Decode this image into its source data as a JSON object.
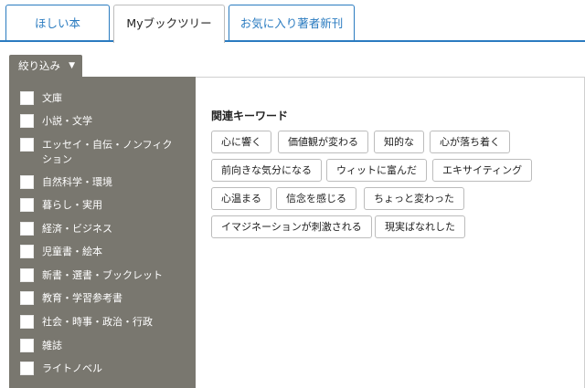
{
  "tabs": [
    {
      "label": "ほしい本"
    },
    {
      "label": "Myブックツリー"
    },
    {
      "label": "お気に入り著者新刊"
    }
  ],
  "filter": {
    "label": "絞り込み",
    "caret": "▼"
  },
  "categories": [
    {
      "label": "文庫"
    },
    {
      "label": "小説・文学"
    },
    {
      "label": "エッセイ・自伝・ノンフィクション"
    },
    {
      "label": "自然科学・環境"
    },
    {
      "label": "暮らし・実用"
    },
    {
      "label": "経済・ビジネス"
    },
    {
      "label": "児童書・絵本"
    },
    {
      "label": "新書・選書・ブックレット"
    },
    {
      "label": "教育・学習参考書"
    },
    {
      "label": "社会・時事・政治・行政"
    },
    {
      "label": "雑誌"
    },
    {
      "label": "ライトノベル"
    }
  ],
  "keywords": {
    "title": "関連キーワード",
    "items": [
      "心に響く",
      "価値観が変わる",
      "知的な",
      "心が落ち着く",
      "前向きな気分になる",
      "ウィットに富んだ",
      "エキサイティング",
      "心温まる",
      "信念を感じる",
      "ちょっと変わった",
      "イマジネーションが刺激される",
      "現実ばなれした"
    ]
  }
}
